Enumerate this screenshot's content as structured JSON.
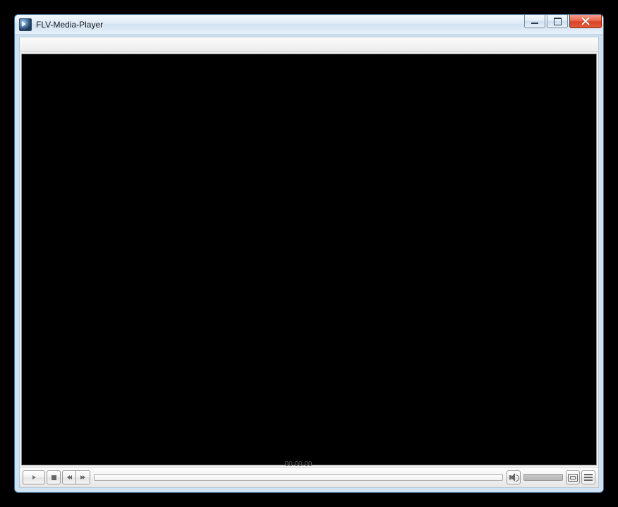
{
  "window": {
    "title": "FLV-Media-Player"
  },
  "playback": {
    "time_display": "00:00:00"
  },
  "icons": {
    "app": "player-app-icon",
    "minimize": "minimize-icon",
    "maximize": "maximize-icon",
    "close": "close-icon",
    "play": "play-icon",
    "stop": "stop-icon",
    "prev": "previous-icon",
    "next": "next-icon",
    "volume": "speaker-icon",
    "fullscreen": "fullscreen-icon",
    "playlist": "playlist-icon"
  }
}
